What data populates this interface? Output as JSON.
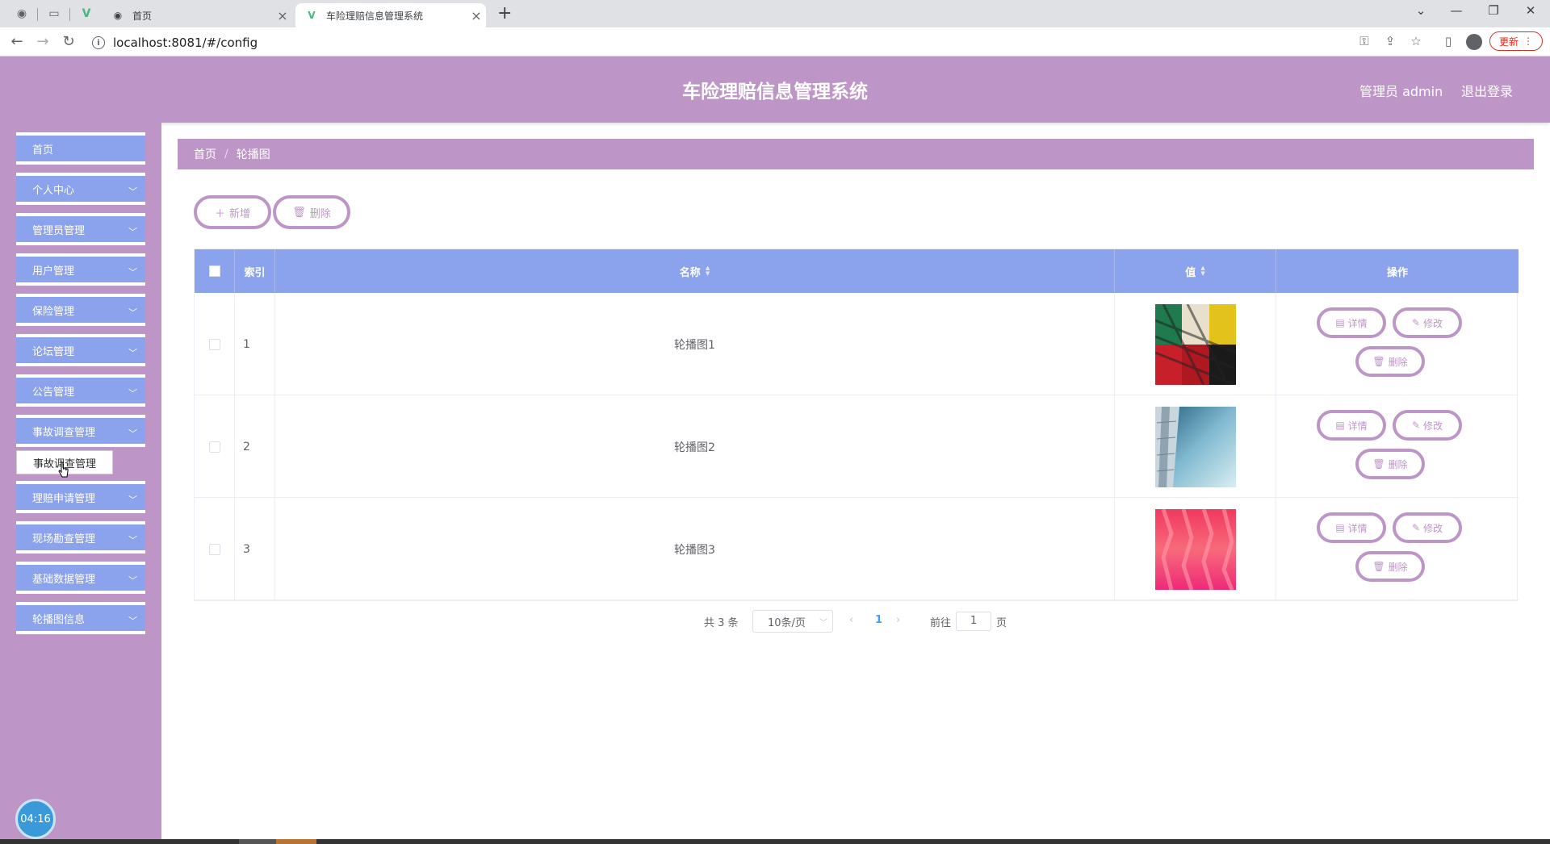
{
  "browser": {
    "inactive_tab_title": "首页",
    "active_tab_title": "车险理赔信息管理系统",
    "url": "localhost:8081/#/config",
    "update_label": "更新"
  },
  "header": {
    "title": "车险理赔信息管理系统",
    "user": "管理员 admin",
    "logout": "退出登录"
  },
  "sidebar": {
    "items": [
      {
        "label": "首页"
      },
      {
        "label": "个人中心"
      },
      {
        "label": "管理员管理"
      },
      {
        "label": "用户管理"
      },
      {
        "label": "保险管理"
      },
      {
        "label": "论坛管理"
      },
      {
        "label": "公告管理"
      },
      {
        "label": "事故调查管理"
      },
      {
        "label": "理赔申请管理"
      },
      {
        "label": "现场勘查管理"
      },
      {
        "label": "基础数据管理"
      },
      {
        "label": "轮播图信息"
      }
    ],
    "tooltip": "事故调查管理",
    "clock": "04:16"
  },
  "breadcrumb": {
    "home": "首页",
    "separator": "/",
    "current": "轮播图"
  },
  "toolbar": {
    "add_label": "新增",
    "delete_label": "删除"
  },
  "table": {
    "headers": {
      "index": "索引",
      "name": "名称",
      "value": "值",
      "actions": "操作"
    },
    "rows": [
      {
        "index": "1",
        "name": "轮播图1",
        "image": "pattern-red-green-yellow"
      },
      {
        "index": "2",
        "name": "轮播图2",
        "image": "building-sky"
      },
      {
        "index": "3",
        "name": "轮播图3",
        "image": "pink-abstract"
      }
    ],
    "actions": {
      "detail": "详情",
      "edit": "修改",
      "delete": "删除"
    }
  },
  "pagination": {
    "total": "共 3 条",
    "page_size": "10条/页",
    "current_page": "1",
    "goto_label": "前往",
    "goto_value": "1",
    "page_unit": "页"
  },
  "colors": {
    "accent_purple": "#bd95c6",
    "menu_blue": "#8ba2ec"
  }
}
